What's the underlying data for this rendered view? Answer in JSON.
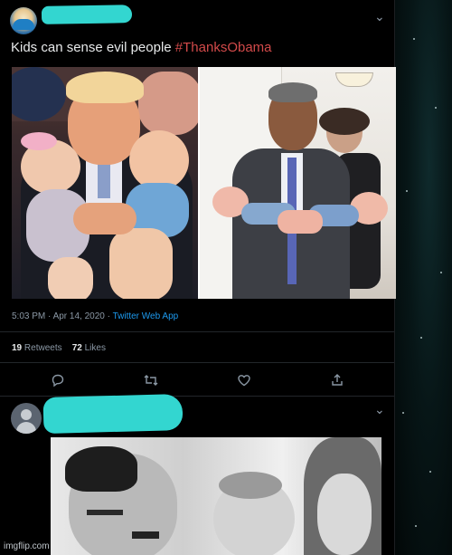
{
  "tweet": {
    "text_plain": "Kids can sense evil people ",
    "hashtag": "#ThanksObama",
    "timestamp": "5:03 PM · Apr 14, 2020 · ",
    "app": "Twitter Web App",
    "retweets_count": "19",
    "retweets_label": "Retweets",
    "likes_count": "72",
    "likes_label": "Likes",
    "more_glyph": "⌄"
  },
  "actions": {
    "reply_icon": "reply-icon",
    "retweet_icon": "retweet-icon",
    "like_icon": "like-icon",
    "share_icon": "share-icon"
  },
  "reply": {
    "more_glyph": "⌄"
  },
  "watermark": "imgflip.com",
  "colors": {
    "hashtag": "#d24a4a",
    "redaction": "#33d6d0",
    "app_link": "#1d9bf0",
    "text": "#e7e9ea",
    "muted": "#8b98a5"
  }
}
